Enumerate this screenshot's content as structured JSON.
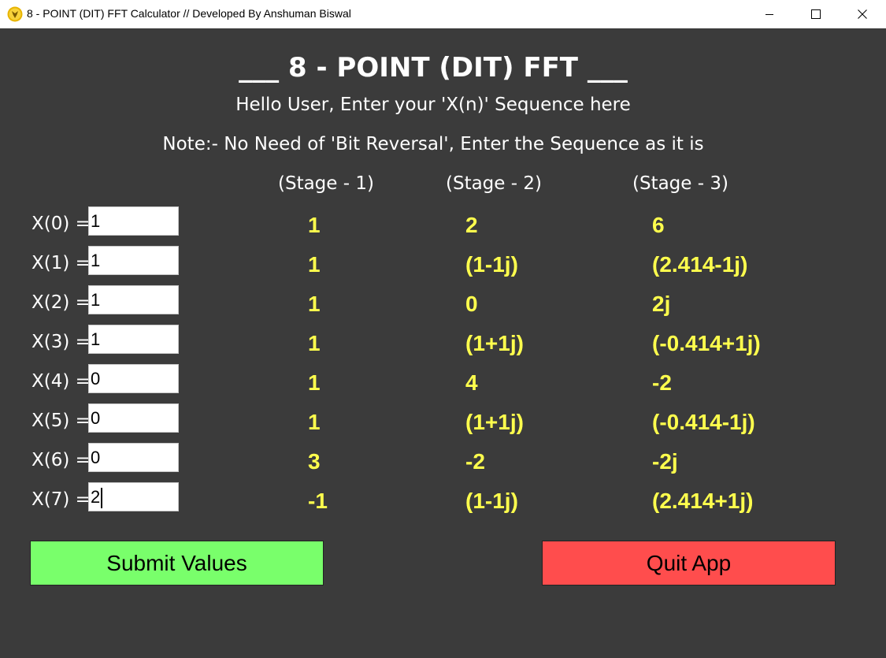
{
  "window": {
    "title": "8 - POINT (DIT) FFT Calculator // Developed By Anshuman Biswal"
  },
  "header": {
    "title": "___ 8 - POINT (DIT) FFT ___",
    "subtitle": "Hello User, Enter your 'X(n)' Sequence here",
    "note": "Note:- No Need of  'Bit Reversal', Enter the Sequence as it is"
  },
  "stages": [
    "(Stage - 1)",
    "(Stage - 2)",
    "(Stage - 3)"
  ],
  "inputs": [
    {
      "label": "X(0) =",
      "value": "1"
    },
    {
      "label": "X(1) =",
      "value": "1"
    },
    {
      "label": "X(2) =",
      "value": "1"
    },
    {
      "label": "X(3) =",
      "value": "1"
    },
    {
      "label": "X(4) =",
      "value": "0"
    },
    {
      "label": "X(5) =",
      "value": "0"
    },
    {
      "label": "X(6) =",
      "value": "0"
    },
    {
      "label": "X(7) =",
      "value": "2"
    }
  ],
  "results": {
    "stage1": [
      "1",
      "1",
      "1",
      "1",
      "1",
      "1",
      "3",
      "-1"
    ],
    "stage2": [
      "2",
      "(1-1j)",
      "0",
      "(1+1j)",
      "4",
      "(1+1j)",
      "-2",
      "(1-1j)"
    ],
    "stage3": [
      "6",
      "(2.414-1j)",
      "2j",
      "(-0.414+1j)",
      "-2",
      "(-0.414-1j)",
      "-2j",
      "(2.414+1j)"
    ]
  },
  "buttons": {
    "submit": "Submit Values",
    "quit": "Quit App"
  },
  "colors": {
    "background": "#3b3b3b",
    "result_text": "#ffff4d",
    "submit_button": "#79ff6b",
    "quit_button": "#ff4d4d"
  }
}
